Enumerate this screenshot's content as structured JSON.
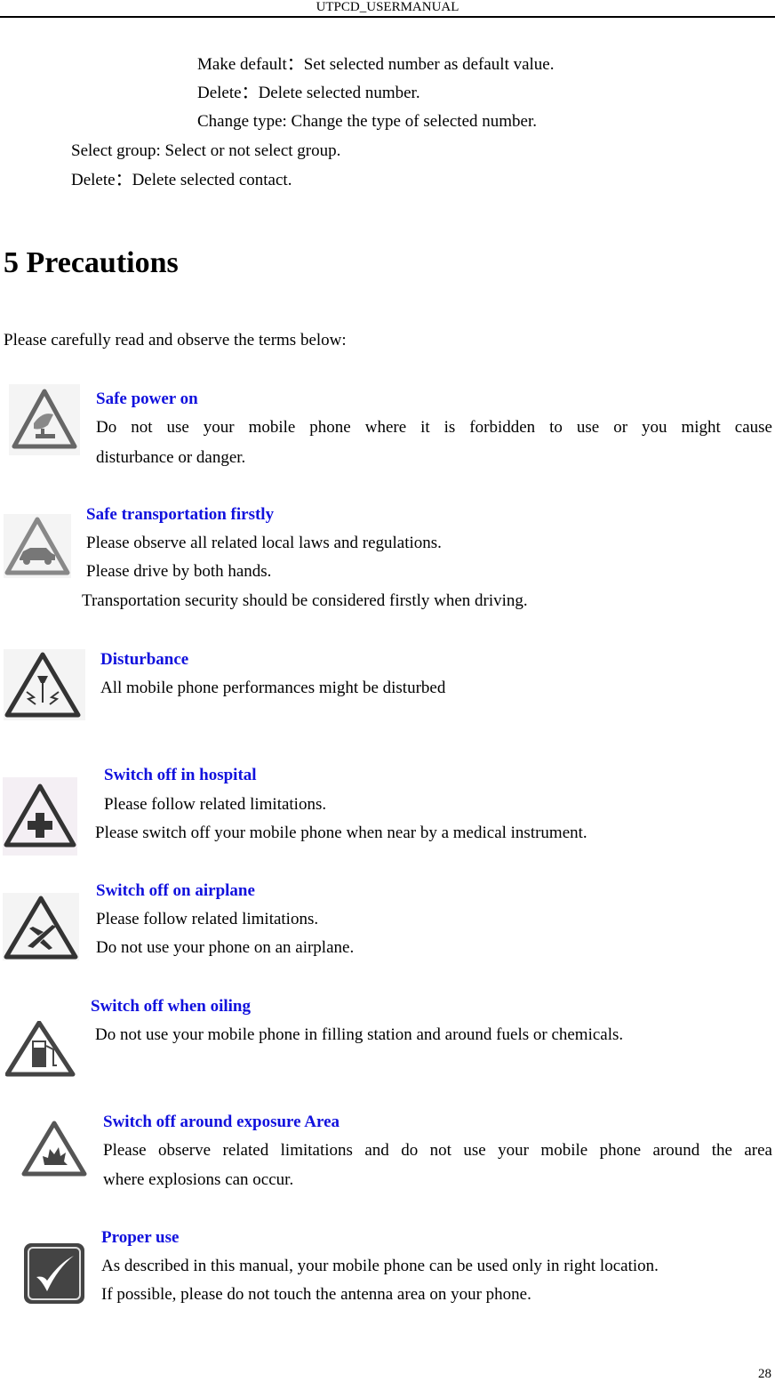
{
  "header": {
    "title": "UTPCD_USERMANUAL"
  },
  "intro_lines": {
    "make_default": "Make default：Set selected number as default value.",
    "delete_number": "Delete：Delete selected number.",
    "change_type": "Change type: Change the type of selected number.",
    "select_group": "Select group: Select or not select group.",
    "delete_contact": "Delete：Delete selected contact."
  },
  "section": {
    "title": "5 Precautions",
    "lead": "Please carefully read and observe the terms below:"
  },
  "precautions": [
    {
      "icon": "hand-power-warning-icon",
      "title": "Safe power on",
      "lines": [
        "Do not use your mobile phone where it is forbidden to use or you might cause",
        "disturbance or danger."
      ]
    },
    {
      "icon": "car-warning-icon",
      "title": "Safe transportation firstly",
      "lines": [
        "Please observe all related local laws and regulations.",
        "Please drive by both hands.",
        "Transportation security should be considered firstly when driving."
      ]
    },
    {
      "icon": "interference-warning-icon",
      "title": "Disturbance",
      "lines": [
        "All mobile phone performances might be disturbed"
      ]
    },
    {
      "icon": "hospital-cross-warning-icon",
      "title": "Switch off in hospital",
      "lines": [
        "Please follow related limitations.",
        "Please switch off your mobile phone when near by a medical instrument."
      ]
    },
    {
      "icon": "airplane-warning-icon",
      "title": "Switch off on airplane",
      "lines": [
        "Please follow related limitations.",
        "Do not use your phone on an airplane."
      ]
    },
    {
      "icon": "fuel-pump-warning-icon",
      "title": "Switch off when oiling",
      "lines": [
        "Do not use your mobile phone in filling station and around fuels or chemicals."
      ]
    },
    {
      "icon": "explosion-warning-icon",
      "title": "Switch off around exposure Area",
      "lines": [
        "Please observe related limitations and do not use your mobile phone around the area",
        "where explosions can occur."
      ]
    },
    {
      "icon": "checkmark-icon",
      "title": "Proper use",
      "lines": [
        "As described in this manual, your mobile phone can be used only in right location.",
        "If possible, please do not touch the antenna area on your phone."
      ]
    }
  ],
  "footer": {
    "page_number": "28"
  }
}
